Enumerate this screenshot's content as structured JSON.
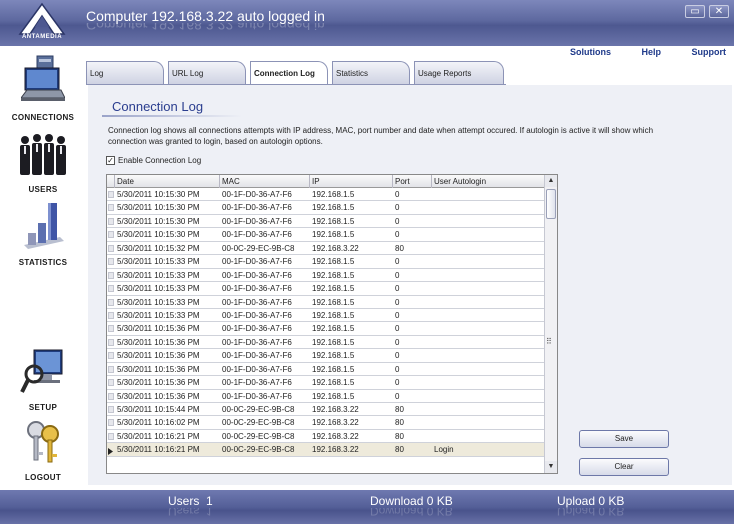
{
  "app": {
    "logo_text": "ANTAMEDIA",
    "title": "Computer 192.168.3.22 auto logged in"
  },
  "window_buttons": {
    "restore": "▭",
    "close": "✕"
  },
  "sidebar": {
    "items": [
      {
        "label": "CONNECTIONS",
        "icon": "computer-icon"
      },
      {
        "label": "USERS",
        "icon": "users-icon"
      },
      {
        "label": "STATISTICS",
        "icon": "bar-chart-icon"
      },
      {
        "label": "SETUP",
        "icon": "setup-icon"
      },
      {
        "label": "LOGOUT",
        "icon": "keys-icon"
      }
    ]
  },
  "toplinks": {
    "solutions": "Solutions",
    "help": "Help",
    "support": "Support"
  },
  "tabs": [
    {
      "label": "Log"
    },
    {
      "label": "URL Log"
    },
    {
      "label": "Connection Log",
      "active": true
    },
    {
      "label": "Statistics"
    },
    {
      "label": "Usage Reports"
    }
  ],
  "page": {
    "title": "Connection Log",
    "description": "Connection log shows all connections attempts with IP address, MAC, port number and date when attempt occured. If autologin is active it will show which connection was granted to login, based on autologin options.",
    "enable_label": "Enable Connection Log",
    "enable_checked": true
  },
  "table": {
    "columns": [
      "Date",
      "MAC",
      "IP",
      "Port",
      "User Autologin"
    ],
    "rows": [
      [
        "5/30/2011 10:15:30 PM",
        "00-1F-D0-36-A7-F6",
        "192.168.1.5",
        "0",
        ""
      ],
      [
        "5/30/2011 10:15:30 PM",
        "00-1F-D0-36-A7-F6",
        "192.168.1.5",
        "0",
        ""
      ],
      [
        "5/30/2011 10:15:30 PM",
        "00-1F-D0-36-A7-F6",
        "192.168.1.5",
        "0",
        ""
      ],
      [
        "5/30/2011 10:15:30 PM",
        "00-1F-D0-36-A7-F6",
        "192.168.1.5",
        "0",
        ""
      ],
      [
        "5/30/2011 10:15:32 PM",
        "00-0C-29-EC-9B-C8",
        "192.168.3.22",
        "80",
        ""
      ],
      [
        "5/30/2011 10:15:33 PM",
        "00-1F-D0-36-A7-F6",
        "192.168.1.5",
        "0",
        ""
      ],
      [
        "5/30/2011 10:15:33 PM",
        "00-1F-D0-36-A7-F6",
        "192.168.1.5",
        "0",
        ""
      ],
      [
        "5/30/2011 10:15:33 PM",
        "00-1F-D0-36-A7-F6",
        "192.168.1.5",
        "0",
        ""
      ],
      [
        "5/30/2011 10:15:33 PM",
        "00-1F-D0-36-A7-F6",
        "192.168.1.5",
        "0",
        ""
      ],
      [
        "5/30/2011 10:15:33 PM",
        "00-1F-D0-36-A7-F6",
        "192.168.1.5",
        "0",
        ""
      ],
      [
        "5/30/2011 10:15:36 PM",
        "00-1F-D0-36-A7-F6",
        "192.168.1.5",
        "0",
        ""
      ],
      [
        "5/30/2011 10:15:36 PM",
        "00-1F-D0-36-A7-F6",
        "192.168.1.5",
        "0",
        ""
      ],
      [
        "5/30/2011 10:15:36 PM",
        "00-1F-D0-36-A7-F6",
        "192.168.1.5",
        "0",
        ""
      ],
      [
        "5/30/2011 10:15:36 PM",
        "00-1F-D0-36-A7-F6",
        "192.168.1.5",
        "0",
        ""
      ],
      [
        "5/30/2011 10:15:36 PM",
        "00-1F-D0-36-A7-F6",
        "192.168.1.5",
        "0",
        ""
      ],
      [
        "5/30/2011 10:15:36 PM",
        "00-1F-D0-36-A7-F6",
        "192.168.1.5",
        "0",
        ""
      ],
      [
        "5/30/2011 10:15:44 PM",
        "00-0C-29-EC-9B-C8",
        "192.168.3.22",
        "80",
        ""
      ],
      [
        "5/30/2011 10:16:02 PM",
        "00-0C-29-EC-9B-C8",
        "192.168.3.22",
        "80",
        ""
      ],
      [
        "5/30/2011 10:16:21 PM",
        "00-0C-29-EC-9B-C8",
        "192.168.3.22",
        "80",
        ""
      ],
      [
        "5/30/2011 10:16:21 PM",
        "00-0C-29-EC-9B-C8",
        "192.168.3.22",
        "80",
        "Login"
      ]
    ],
    "selected_row": 19
  },
  "buttons": {
    "save": "Save",
    "clear": "Clear"
  },
  "status": {
    "users_label": "Users",
    "users_value": "1",
    "download_label": "Download",
    "download_value": "0 KB",
    "upload_label": "Upload",
    "upload_value": "0 KB"
  },
  "colors": {
    "title_bar": "#5d689f",
    "accent": "#2a3d8f",
    "selected_row": "#eeeadb"
  }
}
